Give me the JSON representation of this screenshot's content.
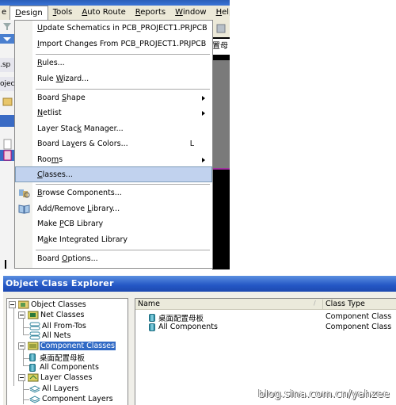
{
  "menubar": {
    "items": [
      {
        "label": "e",
        "state": "clipped"
      },
      {
        "label": "Design",
        "accel": "D",
        "state": "open"
      },
      {
        "label": "Tools",
        "accel": "T"
      },
      {
        "label": "Auto Route",
        "accel": "A"
      },
      {
        "label": "Reports",
        "accel": "R"
      },
      {
        "label": "Window",
        "accel": "W"
      },
      {
        "label": "Help",
        "accel": "H"
      }
    ]
  },
  "background_app": {
    "left_fragments": [
      ".sp",
      "ojec"
    ],
    "right_fragment": "置母"
  },
  "design_menu": {
    "items": [
      {
        "label": "Update Schematics in PCB_PROJECT1.PRJPCB"
      },
      {
        "label": "Import Changes From PCB_PROJECT1.PRJPCB"
      },
      {
        "separator": true
      },
      {
        "label": "Rules..."
      },
      {
        "label": "Rule Wizard..."
      },
      {
        "separator": true
      },
      {
        "label": "Board Shape",
        "submenu": true
      },
      {
        "label": "Netlist",
        "submenu": true
      },
      {
        "label": "Layer Stack Manager..."
      },
      {
        "label": "Board Layers & Colors...",
        "shortcut": "L"
      },
      {
        "label": "Rooms",
        "submenu": true
      },
      {
        "label": "Classes...",
        "highlighted": true
      },
      {
        "separator": true
      },
      {
        "label": "Browse Components...",
        "icon": "browse-components-icon"
      },
      {
        "label": "Add/Remove Library...",
        "icon": "library-book-icon"
      },
      {
        "label": "Make PCB Library"
      },
      {
        "label": "Make Integrated Library"
      },
      {
        "separator": true
      },
      {
        "label": "Board Options..."
      }
    ]
  },
  "object_class_explorer": {
    "title": "Object Class Explorer",
    "tree": [
      {
        "label": "Object Classes",
        "level": 0,
        "expanded": true,
        "icon": "object-classes-folder-icon"
      },
      {
        "label": "Net Classes",
        "level": 1,
        "expanded": true,
        "icon": "net-classes-folder-icon"
      },
      {
        "label": "All From-Tos",
        "level": 2,
        "icon": "net-icon"
      },
      {
        "label": "All Nets",
        "level": 2,
        "icon": "net-icon"
      },
      {
        "label": "Component Classes",
        "level": 1,
        "expanded": true,
        "selected": true,
        "icon": "component-classes-folder-icon"
      },
      {
        "label": "桌面配置母板",
        "level": 2,
        "icon": "component-icon"
      },
      {
        "label": "All Components",
        "level": 2,
        "icon": "component-icon"
      },
      {
        "label": "Layer Classes",
        "level": 1,
        "expanded": true,
        "icon": "layer-classes-folder-icon"
      },
      {
        "label": "All Layers",
        "level": 2,
        "icon": "layer-icon"
      },
      {
        "label": "Component Layers",
        "level": 2,
        "icon": "layer-icon"
      }
    ],
    "list": {
      "columns": [
        "Name",
        "Class Type"
      ],
      "sort_indicator": "/",
      "rows": [
        {
          "name": "桌面配置母板",
          "type": "Component Class"
        },
        {
          "name": "All Components",
          "type": "Component Class"
        }
      ]
    }
  },
  "watermark": "blog.sina.com.cn/yahzee"
}
